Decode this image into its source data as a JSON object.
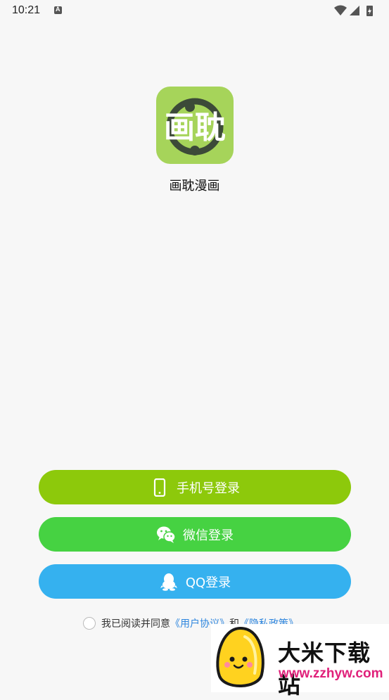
{
  "status_bar": {
    "time": "10:21",
    "badge": "A"
  },
  "app": {
    "name": "画耽漫画",
    "logo_text": "画耽",
    "logo_color": "#a6d45a"
  },
  "buttons": {
    "phone": {
      "label": "手机号登录",
      "icon": "phone-icon",
      "color": "#8dc90b"
    },
    "wechat": {
      "label": "微信登录",
      "icon": "wechat-icon",
      "color": "#46d242"
    },
    "qq": {
      "label": "QQ登录",
      "icon": "qq-penguin-icon",
      "color": "#35b1ef"
    }
  },
  "agreement": {
    "prefix": "我已阅读并同意",
    "user_agreement": "《用户协议》",
    "conjunction": "和",
    "privacy_policy": "《隐私政策》"
  },
  "watermark": {
    "title": "大米下载站",
    "url": "www.zzhyw.com"
  }
}
